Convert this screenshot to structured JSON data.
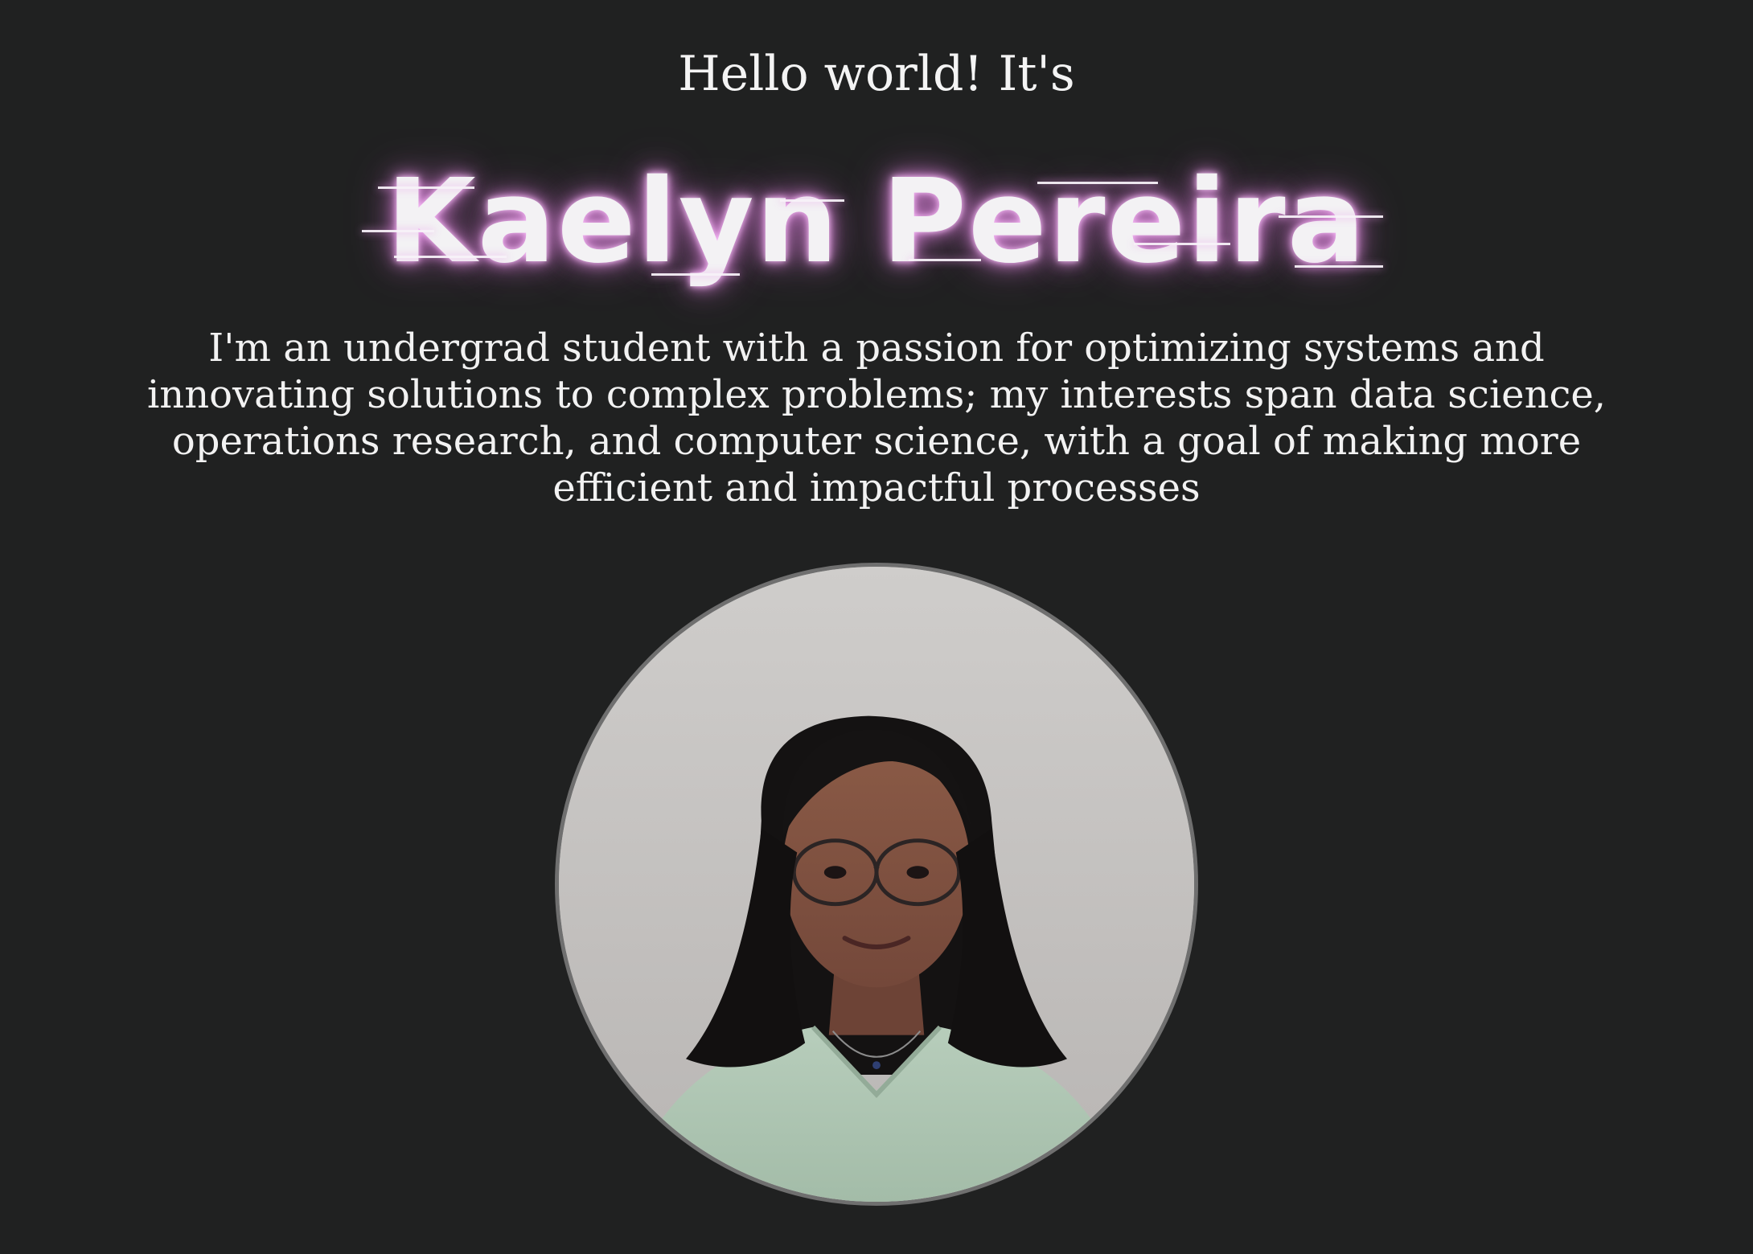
{
  "hero": {
    "greeting": "Hello world! It's",
    "name": "Kaelyn Pereira",
    "bio": "I'm an undergrad student with a passion for optimizing systems and innovating solutions to complex problems; my interests span data science, operations research, and computer science, with a goal of making more efficient and impactful processes"
  },
  "colors": {
    "background": "#202121",
    "text": "#f2f2f2",
    "name_glow": "#d678d6",
    "portrait_border": "#6f6f6f"
  }
}
